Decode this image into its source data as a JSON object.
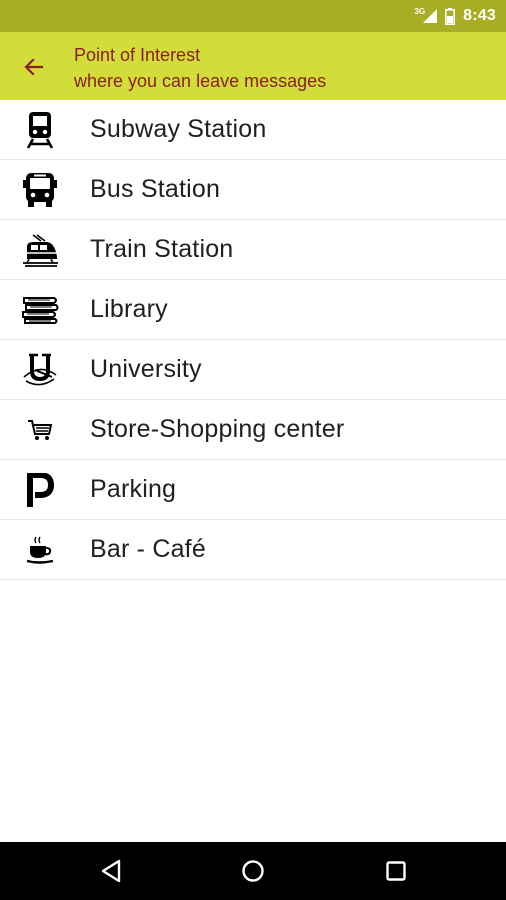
{
  "status_bar": {
    "network": "3G",
    "time": "8:43",
    "signal_icon": "signal-icon",
    "battery_icon": "battery-icon"
  },
  "app_bar": {
    "back_icon": "arrow-back-icon",
    "title": "Point of Interest",
    "subtitle": "where you can leave messages",
    "background": "#d2dc3a",
    "text_color": "#8a1f1f"
  },
  "list": {
    "items": [
      {
        "label": "Subway Station",
        "icon": "subway-icon"
      },
      {
        "label": "Bus Station",
        "icon": "bus-icon"
      },
      {
        "label": "Train Station",
        "icon": "train-icon"
      },
      {
        "label": "Library",
        "icon": "books-icon"
      },
      {
        "label": "University",
        "icon": "university-icon"
      },
      {
        "label": "Store-Shopping center",
        "icon": "shopping-cart-icon"
      },
      {
        "label": "Parking",
        "icon": "parking-icon"
      },
      {
        "label": "Bar - Café",
        "icon": "coffee-cup-icon"
      }
    ]
  },
  "nav_bar": {
    "back_icon": "nav-back-icon",
    "home_icon": "nav-home-icon",
    "recents_icon": "nav-recents-icon"
  }
}
